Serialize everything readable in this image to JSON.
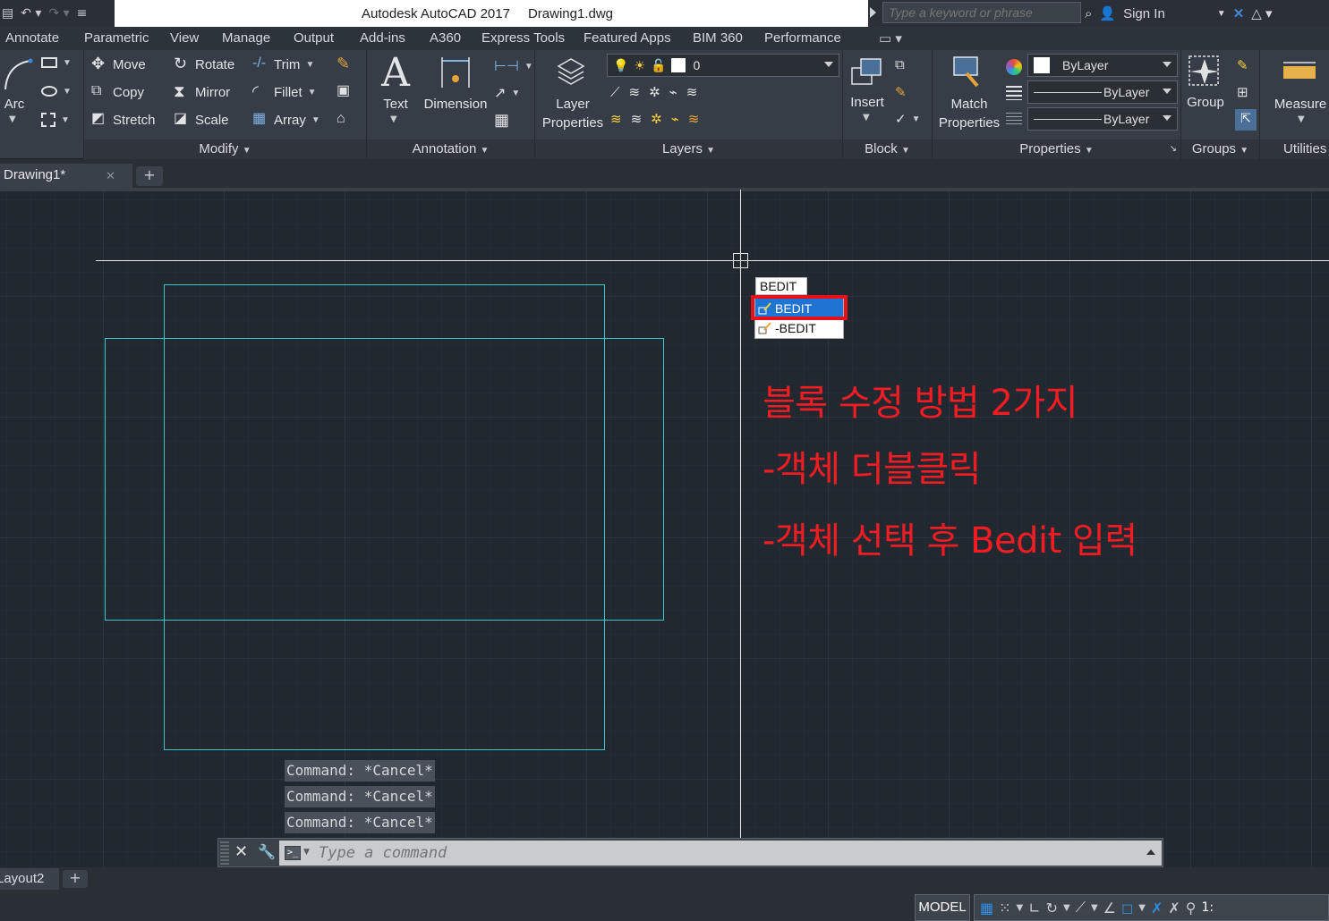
{
  "titlebar": {
    "app": "Autodesk AutoCAD 2017",
    "file": "Drawing1.dwg",
    "search_placeholder": "Type a keyword or phrase",
    "sign_in": "Sign In"
  },
  "menu": [
    "Annotate",
    "Parametric",
    "View",
    "Manage",
    "Output",
    "Add-ins",
    "A360",
    "Express Tools",
    "Featured Apps",
    "BIM 360",
    "Performance"
  ],
  "ribbon": {
    "draw": {
      "arc": "Arc"
    },
    "modify": {
      "title": "Modify",
      "move": "Move",
      "rotate": "Rotate",
      "trim": "Trim",
      "copy": "Copy",
      "mirror": "Mirror",
      "fillet": "Fillet",
      "stretch": "Stretch",
      "scale": "Scale",
      "array": "Array"
    },
    "annotation": {
      "title": "Annotation",
      "text": "Text",
      "dimension": "Dimension"
    },
    "layers": {
      "title": "Layers",
      "layer_props_1": "Layer",
      "layer_props_2": "Properties",
      "current_layer": "0"
    },
    "block": {
      "title": "Block",
      "insert": "Insert"
    },
    "properties": {
      "title": "Properties",
      "match_1": "Match",
      "match_2": "Properties",
      "color": "ByLayer",
      "linetype": "ByLayer",
      "lineweight": "ByLayer"
    },
    "groups": {
      "title": "Groups",
      "group": "Group"
    },
    "utilities": {
      "title": "Utilities",
      "measure": "Measure"
    }
  },
  "tabs": {
    "active": "Drawing1*",
    "close": "✕",
    "plus": "+"
  },
  "autocomplete": {
    "typed": "BEDIT",
    "items": [
      {
        "label": "BEDIT",
        "selected": true
      },
      {
        "label": "-BEDIT",
        "selected": false
      }
    ]
  },
  "notes": [
    "블록 수정 방법 2가지",
    "-객체 더블클릭",
    "-객체 선택 후 Bedit 입력"
  ],
  "command_history": [
    "Command: *Cancel*",
    "Command: *Cancel*",
    "Command: *Cancel*"
  ],
  "command_line": {
    "placeholder": "Type a command",
    "close": "✕"
  },
  "layout_tabs": {
    "tab": "Layout2",
    "plus": "+"
  },
  "status": {
    "model": "MODEL",
    "scale": "1:"
  },
  "colors": {
    "cyan_shape": "#34c9cc",
    "annotation_red": "#f21c22",
    "highlight": "#e8101a",
    "selection_blue": "#1f73d1"
  }
}
